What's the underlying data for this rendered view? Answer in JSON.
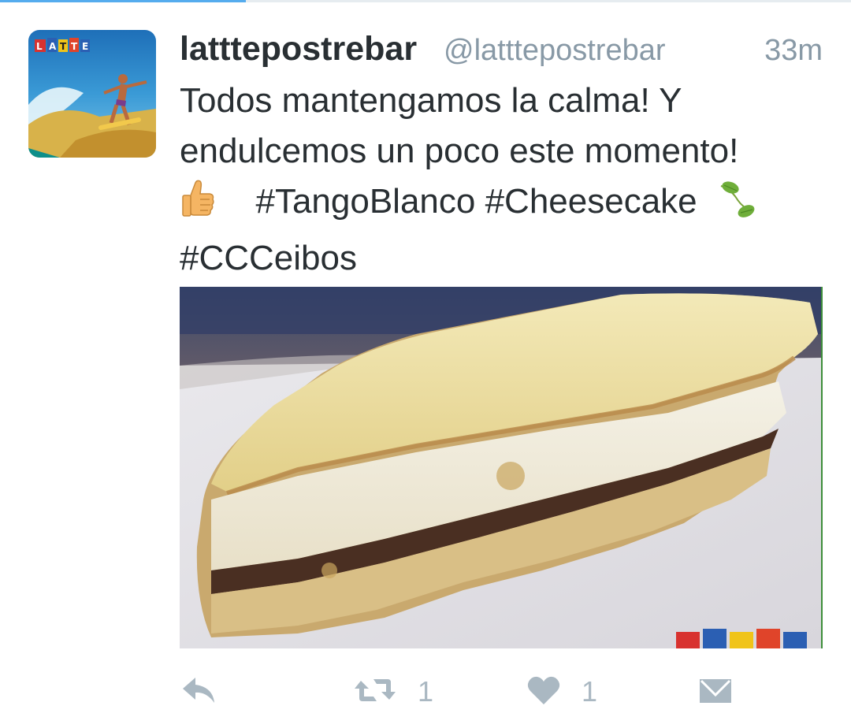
{
  "tweet": {
    "display_name": "latttepostrebar",
    "handle": "@latttepostrebar",
    "timestamp": "33m",
    "text_lines": [
      "Todos mantengamos la calma! Y",
      "endulcemos un poco este momento!",
      "#TangoBlanco #Cheesecake",
      "#CCCeibos"
    ],
    "emoji": [
      "thumbs-up-emoji",
      "herb-emoji"
    ],
    "media_description": "cheesecake-photo"
  },
  "actions": {
    "reply_icon": "reply-icon",
    "retweet_icon": "retweet-icon",
    "retweet_count": "1",
    "like_icon": "heart-icon",
    "like_count": "1",
    "dm_icon": "envelope-icon"
  },
  "colors": {
    "text": "#292f33",
    "muted": "#8899a6",
    "action_gray": "#aab8c2",
    "accent": "#55acee"
  }
}
